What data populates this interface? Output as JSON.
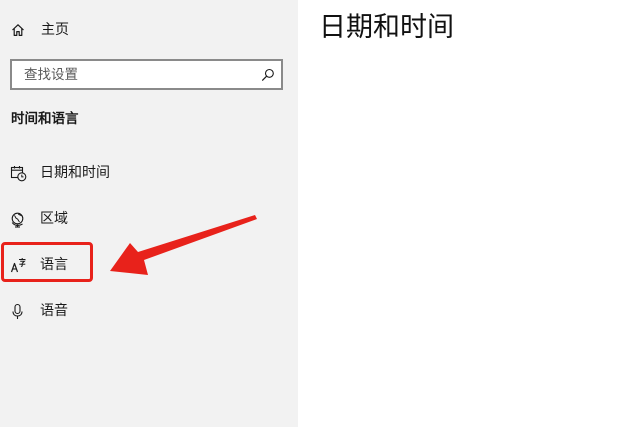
{
  "sidebar": {
    "home_label": "主页",
    "search": {
      "placeholder": "查找设置",
      "value": ""
    },
    "section_heading": "时间和语言",
    "items": [
      {
        "label": "日期和时间",
        "icon": "calendar-clock-icon"
      },
      {
        "label": "区域",
        "icon": "globe-region-icon"
      },
      {
        "label": "语言",
        "icon": "language-icon",
        "highlighted": true
      },
      {
        "label": "语音",
        "icon": "microphone-icon"
      }
    ]
  },
  "main": {
    "title": "日期和时间"
  },
  "annotation": {
    "highlight_color": "#e8221b",
    "arrow_color": "#e8221b",
    "points_to": "语言"
  },
  "colors": {
    "sidebar_bg": "#f2f2f2",
    "main_bg": "#ffffff",
    "text": "#1a1a1a",
    "search_border": "#8a8a8a"
  }
}
